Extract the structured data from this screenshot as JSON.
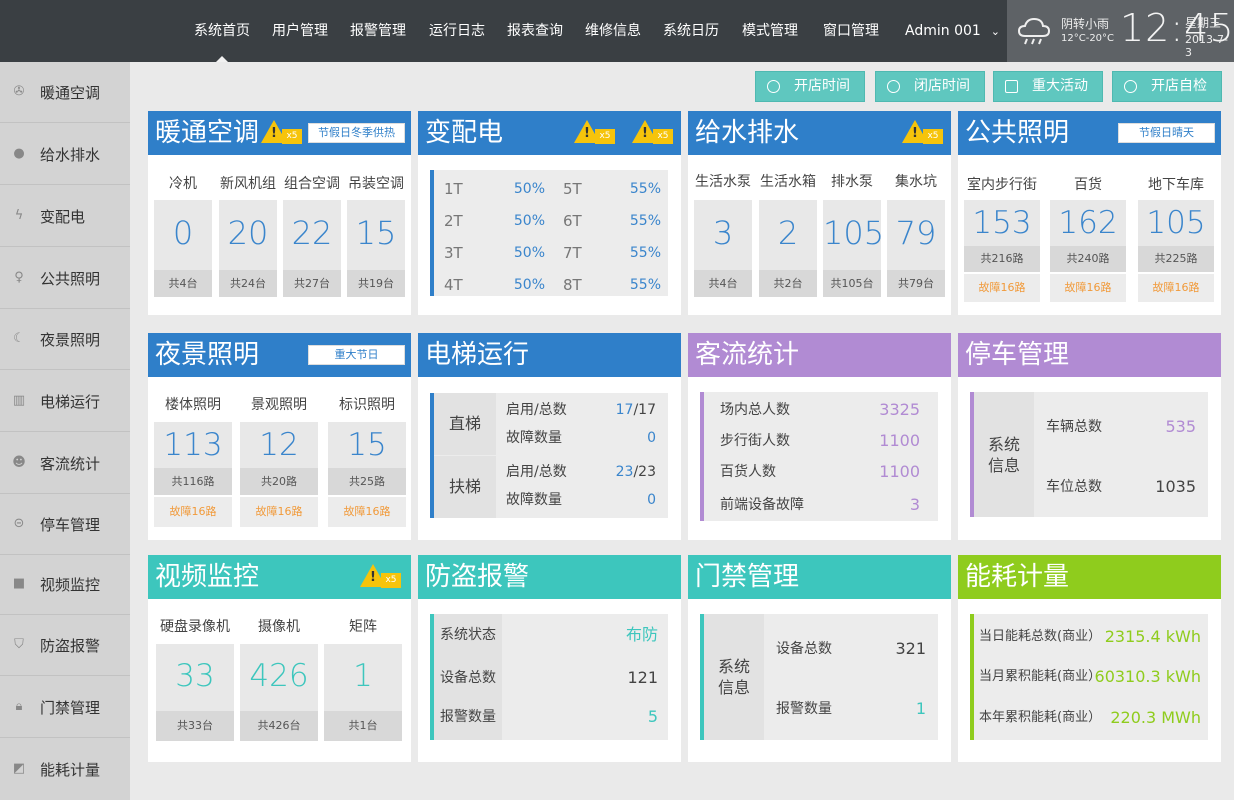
{
  "nav": {
    "items": [
      "系统首页",
      "用户管理",
      "报警管理",
      "运行日志",
      "报表查询",
      "维修信息",
      "系统日历",
      "模式管理",
      "窗口管理"
    ],
    "user": "Admin 001"
  },
  "weather": {
    "condition": "阴转小雨",
    "temp": "12°C-20°C",
    "time": "12:45",
    "weekday": "星期三",
    "date": "2013-7-3"
  },
  "sidebar": [
    "暖通空调",
    "给水排水",
    "变配电",
    "公共照明",
    "夜景照明",
    "电梯运行",
    "客流统计",
    "停车管理",
    "视频监控",
    "防盗报警",
    "门禁管理",
    "能耗计量"
  ],
  "actions": [
    "开店时间",
    "闭店时间",
    "重大活动",
    "开店自检"
  ],
  "hvac": {
    "title": "暖通空调",
    "badge": "x5",
    "tag": "节假日冬季供热",
    "cols": [
      {
        "name": "冷机",
        "value": "0",
        "sub": "共4台"
      },
      {
        "name": "新风机组",
        "value": "20",
        "sub": "共24台"
      },
      {
        "name": "组合空调",
        "value": "22",
        "sub": "共27台"
      },
      {
        "name": "吊装空调",
        "value": "15",
        "sub": "共19台"
      }
    ]
  },
  "power": {
    "title": "变配电",
    "badge1": "x5",
    "badge2": "x5",
    "left": [
      {
        "name": "1T",
        "value": "50%"
      },
      {
        "name": "2T",
        "value": "50%"
      },
      {
        "name": "3T",
        "value": "50%"
      },
      {
        "name": "4T",
        "value": "50%"
      }
    ],
    "right": [
      {
        "name": "5T",
        "value": "55%"
      },
      {
        "name": "6T",
        "value": "55%"
      },
      {
        "name": "7T",
        "value": "55%"
      },
      {
        "name": "8T",
        "value": "55%"
      }
    ]
  },
  "water": {
    "title": "给水排水",
    "badge": "x5",
    "cols": [
      {
        "name": "生活水泵",
        "value": "3",
        "sub": "共4台"
      },
      {
        "name": "生活水箱",
        "value": "2",
        "sub": "共2台"
      },
      {
        "name": "排水泵",
        "value": "105",
        "sub": "共105台"
      },
      {
        "name": "集水坑",
        "value": "79",
        "sub": "共79台"
      }
    ]
  },
  "lighting": {
    "title": "公共照明",
    "tag": "节假日晴天",
    "cols": [
      {
        "name": "室内步行街",
        "value": "153",
        "sub": "共216路",
        "fault": "故障16路"
      },
      {
        "name": "百货",
        "value": "162",
        "sub": "共240路",
        "fault": "故障16路"
      },
      {
        "name": "地下车库",
        "value": "105",
        "sub": "共225路",
        "fault": "故障16路"
      }
    ]
  },
  "night": {
    "title": "夜景照明",
    "tag": "重大节日",
    "cols": [
      {
        "name": "楼体照明",
        "value": "113",
        "sub": "共116路",
        "fault": "故障16路"
      },
      {
        "name": "景观照明",
        "value": "12",
        "sub": "共20路",
        "fault": "故障16路"
      },
      {
        "name": "标识照明",
        "value": "15",
        "sub": "共25路",
        "fault": "故障16路"
      }
    ]
  },
  "elevator": {
    "title": "电梯运行",
    "groups": [
      {
        "name": "直梯",
        "rows": [
          {
            "label": "启用/总数",
            "value": "17",
            "total": "/17"
          },
          {
            "label": "故障数量",
            "value": "0",
            "total": ""
          }
        ]
      },
      {
        "name": "扶梯",
        "rows": [
          {
            "label": "启用/总数",
            "value": "23",
            "total": "/23"
          },
          {
            "label": "故障数量",
            "value": "0",
            "total": ""
          }
        ]
      }
    ]
  },
  "traffic": {
    "title": "客流统计",
    "rows": [
      {
        "label": "场内总人数",
        "value": "3325"
      },
      {
        "label": "步行街人数",
        "value": "1100"
      },
      {
        "label": "百货人数",
        "value": "1100"
      },
      {
        "label": "前端设备故障",
        "value": "3"
      }
    ]
  },
  "parking": {
    "title": "停车管理",
    "group": "系统信息",
    "rows": [
      {
        "label": "车辆总数",
        "value": "535"
      },
      {
        "label": "车位总数",
        "value": "1035"
      }
    ]
  },
  "video": {
    "title": "视频监控",
    "badge": "x5",
    "cols": [
      {
        "name": "硬盘录像机",
        "value": "33",
        "sub": "共33台"
      },
      {
        "name": "摄像机",
        "value": "426",
        "sub": "共426台"
      },
      {
        "name": "矩阵",
        "value": "1",
        "sub": "共1台"
      }
    ]
  },
  "alarm": {
    "title": "防盗报警",
    "rows": [
      {
        "label": "系统状态",
        "value": "布防"
      },
      {
        "label": "设备总数",
        "value": "121"
      },
      {
        "label": "报警数量",
        "value": "5"
      }
    ]
  },
  "access": {
    "title": "门禁管理",
    "group": "系统信息",
    "rows": [
      {
        "label": "设备总数",
        "value": "321"
      },
      {
        "label": "报警数量",
        "value": "1"
      }
    ]
  },
  "energy": {
    "title": "能耗计量",
    "rows": [
      {
        "label": "当日能耗总数(商业）",
        "value": "2315.4 kWh"
      },
      {
        "label": "当月累积能耗(商业）",
        "value": "60310.3 kWh"
      },
      {
        "label": "本年累积能耗(商业）",
        "value": "220.3 MWh"
      }
    ]
  },
  "colors": {
    "blue": "#2f7fc9",
    "purple": "#b18bd3",
    "teal": "#3dc6bd",
    "green": "#8fcc1d",
    "warning": "#f6c40b",
    "fault": "#f19a3a"
  },
  "icons": [
    "cloud-rain-icon",
    "fan-icon",
    "water-drop-icon",
    "bolt-icon",
    "bulb-icon",
    "night-light-icon",
    "elevator-icon",
    "people-icon",
    "car-icon",
    "camera-icon",
    "shield-icon",
    "lock-icon",
    "meter-icon",
    "clock-icon",
    "calendar-icon",
    "warning-icon"
  ]
}
